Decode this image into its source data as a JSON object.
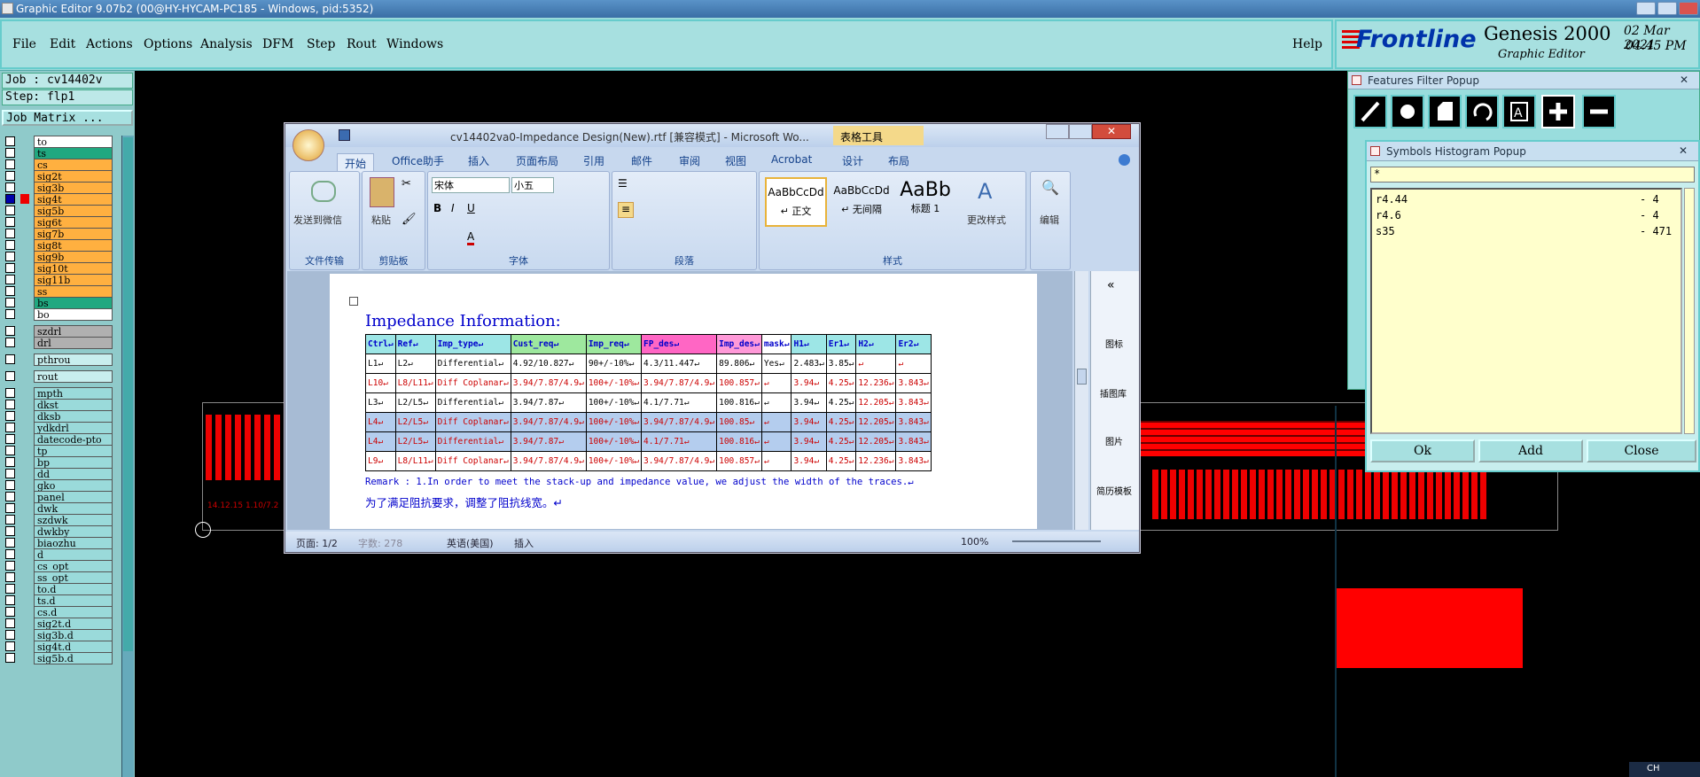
{
  "window": {
    "title": "Graphic Editor 9.07b2 (00@HY-HYCAM-PC185 - Windows, pid:5352)"
  },
  "menu": {
    "items": [
      "File",
      "Edit",
      "Actions",
      "Options",
      "Analysis",
      "DFM",
      "Step",
      "Rout",
      "Windows"
    ],
    "help": "Help"
  },
  "brand": {
    "logo": "Frontline",
    "product": "Genesis 2000",
    "subtitle": "Graphic Editor",
    "date": "02 Mar 2021",
    "time": "04:45 PM"
  },
  "job": {
    "job_label": "Job : cv14402v",
    "step_label": "Step: flp1",
    "matrix_button": "Job Matrix ..."
  },
  "layers": {
    "board": [
      {
        "name": "to",
        "color": "#ffffff"
      },
      {
        "name": "ts",
        "color": "#20a880"
      },
      {
        "name": "cs",
        "color": "#ffb040"
      },
      {
        "name": "sig2t",
        "color": "#ffb040"
      },
      {
        "name": "sig3b",
        "color": "#ffb040"
      },
      {
        "name": "sig4t",
        "color": "#ffb040"
      },
      {
        "name": "sig5b",
        "color": "#ffb040"
      },
      {
        "name": "sig6t",
        "color": "#ffb040"
      },
      {
        "name": "sig7b",
        "color": "#ffb040"
      },
      {
        "name": "sig8t",
        "color": "#ffb040"
      },
      {
        "name": "sig9b",
        "color": "#ffb040"
      },
      {
        "name": "sig10t",
        "color": "#ffb040"
      },
      {
        "name": "sig11b",
        "color": "#ffb040"
      },
      {
        "name": "ss",
        "color": "#ffb040"
      },
      {
        "name": "bs",
        "color": "#20a880"
      },
      {
        "name": "bo",
        "color": "#ffffff"
      }
    ],
    "drill": [
      {
        "name": "szdrl",
        "color": "#b0b0b0"
      },
      {
        "name": "drl",
        "color": "#b0b0b0"
      }
    ],
    "misc1": [
      {
        "name": "pthrou",
        "color": "#c8eeee"
      }
    ],
    "misc2": [
      {
        "name": "rout",
        "color": "#c8eeee"
      }
    ],
    "misc": [
      "mpth",
      "dkst",
      "dksb",
      "ydkdrl",
      "datecode-pto",
      "tp",
      "bp",
      "dd",
      "gko",
      "panel",
      "dwk",
      "szdwk",
      "dwkby",
      "biaozhu",
      "d",
      "cs_opt",
      "ss_opt",
      "to.d",
      "ts.d",
      "cs.d",
      "sig2t.d",
      "sig3b.d",
      "sig4t.d",
      "sig5b.d"
    ]
  },
  "canvas": {
    "small_label": "14.12.15 1.10/7.2"
  },
  "word": {
    "title": "cv14402va0-Impedance Design(New).rtf [兼容模式] - Microsoft Wo...",
    "table_tools": "表格工具",
    "tabs": [
      "开始",
      "Office助手",
      "插入",
      "页面布局",
      "引用",
      "邮件",
      "审阅",
      "视图",
      "Acrobat",
      "设计",
      "布局"
    ],
    "ribbon": {
      "wechat": "发送到微信",
      "clipboard_paste": "粘贴",
      "font_name": "宋体",
      "font_size": "小五",
      "styles": [
        {
          "sample": "AaBbCcDd",
          "name": "↵ 正文"
        },
        {
          "sample": "AaBbCcDd",
          "name": "↵ 无间隔"
        },
        {
          "sample": "AaBb",
          "name": "标题 1"
        }
      ],
      "change_styles": "更改样式",
      "edit": "编辑",
      "groups": [
        "文件传输",
        "剪贴板",
        "字体",
        "段落",
        "样式"
      ]
    },
    "side_panel": [
      "图标",
      "插图库",
      "图片",
      "简历模板"
    ],
    "doc": {
      "heading": "Impedance Information:",
      "columns": [
        "Ctrl↵",
        "Ref↵",
        "Imp_type↵",
        "Cust_req↵",
        "Imp_req↵",
        "FP_des↵",
        "Imp_des↵",
        "mask↵",
        "H1↵",
        "Er1↵",
        "H2↵",
        "Er2↵"
      ],
      "header_colors": [
        "#9de6e6",
        "#9de6e6",
        "#9de6e6",
        "#9ee89e",
        "#9ee89e",
        "#ff66c4",
        "#ff99d8",
        "#ffffff",
        "#9de6e6",
        "#9de6e6",
        "#9de6e6",
        "#9de6e6"
      ],
      "rows": [
        {
          "cells": [
            "L1↵",
            "L2↵",
            "Differential↵",
            "4.92/10.827↵",
            "90+/-10%↵",
            "4.3/11.447↵",
            "89.806↵",
            "Yes↵",
            "2.483↵",
            "3.85↵",
            "↵",
            "↵"
          ],
          "style": "normal"
        },
        {
          "cells": [
            "L10↵",
            "L8/L11↵",
            "Diff Coplanar↵",
            "3.94/7.87/4.9↵",
            "100+/-10%↵",
            "3.94/7.87/4.9↵",
            "100.857↵",
            "↵",
            "3.94↵",
            "4.25↵",
            "12.236↵",
            "3.843↵"
          ],
          "style": "red"
        },
        {
          "cells": [
            "L3↵",
            "L2/L5↵",
            "Differential↵",
            "3.94/7.87↵",
            "100+/-10%↵",
            "4.1/7.71↵",
            "100.816↵",
            "↵",
            "3.94↵",
            "4.25↵",
            "12.205↵",
            "3.843↵"
          ],
          "style": "normal"
        },
        {
          "cells": [
            "L4↵",
            "L2/L5↵",
            "Diff Coplanar↵",
            "3.94/7.87/4.9↵",
            "100+/-10%↵",
            "3.94/7.87/4.9↵",
            "100.85↵",
            "↵",
            "3.94↵",
            "4.25↵",
            "12.205↵",
            "3.843↵"
          ],
          "style": "sel"
        },
        {
          "cells": [
            "L4↵",
            "L2/L5↵",
            "Differential↵",
            "3.94/7.87↵",
            "100+/-10%↵",
            "4.1/7.71↵",
            "100.816↵",
            "↵",
            "3.94↵",
            "4.25↵",
            "12.205↵",
            "3.843↵"
          ],
          "style": "sel"
        },
        {
          "cells": [
            "L9↵",
            "L8/L11↵",
            "Diff Coplanar↵",
            "3.94/7.87/4.9↵",
            "100+/-10%↵",
            "3.94/7.87/4.9↵",
            "100.857↵",
            "↵",
            "3.94↵",
            "4.25↵",
            "12.236↵",
            "3.843↵"
          ],
          "style": "red"
        }
      ],
      "remark": "Remark : 1.In order to meet the stack-up and impedance value, we adjust the width of the traces.↵",
      "remark_cn": "为了满足阻抗要求，调整了阻抗线宽。↵"
    },
    "status": {
      "page": "页面: 1/2",
      "words": "字数: 278",
      "language": "英语(美国)",
      "mode": "插入",
      "zoom": "100%"
    }
  },
  "features_filter": {
    "title": "Features Filter Popup"
  },
  "symbols_histogram": {
    "title": "Symbols Histogram Popup",
    "filter": "*",
    "rows": [
      {
        "sym": "r4.44",
        "count": "- 4"
      },
      {
        "sym": "r4.6",
        "count": "- 4"
      },
      {
        "sym": "s35",
        "count": "- 471"
      }
    ],
    "buttons": [
      "Ok",
      "Add",
      "Close"
    ]
  },
  "tray": {
    "lang": "CH"
  }
}
